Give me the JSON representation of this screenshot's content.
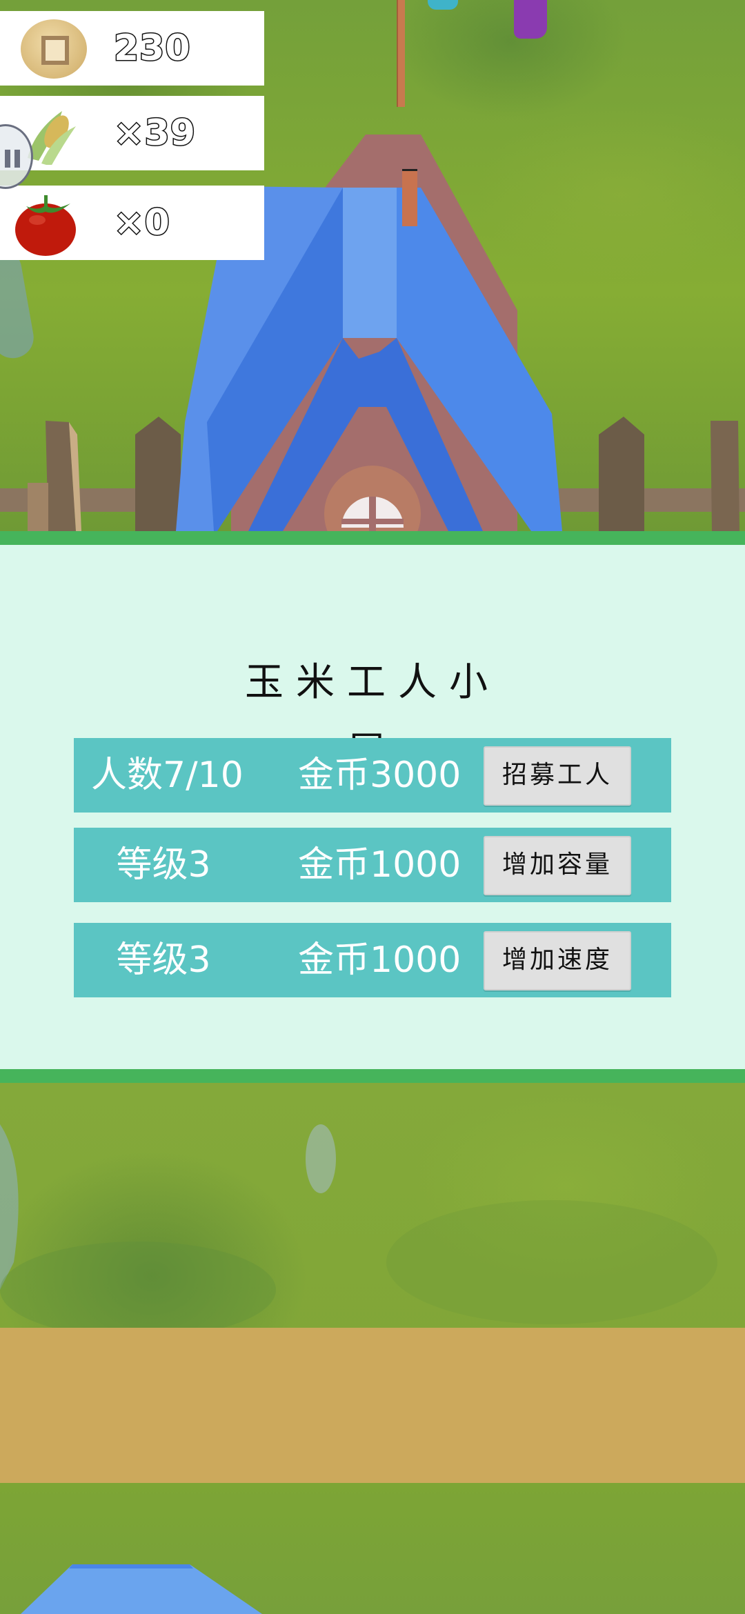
{
  "hud": {
    "coins": {
      "icon": "coin-icon",
      "value": "230"
    },
    "corn": {
      "icon": "corn-icon",
      "value": "×39"
    },
    "tomato": {
      "icon": "tomato-icon",
      "value": "×0"
    }
  },
  "controls": {
    "pause_icon": "pause-icon"
  },
  "panel": {
    "title": "玉米工人小屋",
    "rows": [
      {
        "status": "人数7/10",
        "cost": "金币3000",
        "button": "招募工人"
      },
      {
        "status": "等级3",
        "cost": "金币1000",
        "button": "增加容量"
      },
      {
        "status": "等级3",
        "cost": "金币1000",
        "button": "增加速度"
      }
    ]
  },
  "colors": {
    "panel_bg": "#daf8ec",
    "panel_border": "#46b45b",
    "row_bg": "#5bc5c3",
    "button_bg": "#e0e0e0",
    "roof_blue": "#4a86e8",
    "grass": "#7da431",
    "dirt": "#cca95c"
  }
}
